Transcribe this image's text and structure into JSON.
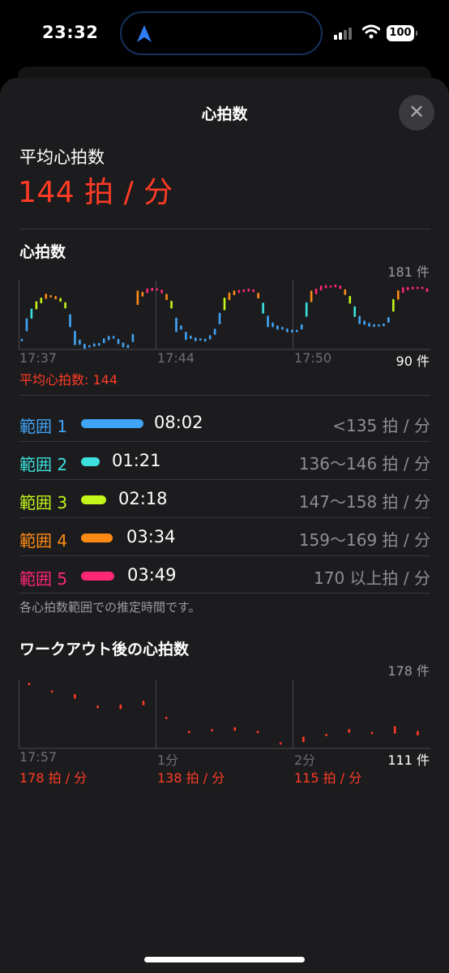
{
  "status": {
    "time": "23:32",
    "battery": "100"
  },
  "sheet": {
    "title": "心拍数",
    "close": "✕"
  },
  "average": {
    "label": "平均心拍数",
    "value": "144 拍 / 分"
  },
  "hr_chart": {
    "title": "心拍数",
    "count_top": "181 件",
    "count_bottom": "90 件",
    "time_labels": [
      "17:37",
      "17:44",
      "17:50"
    ],
    "avg_note": "平均心拍数: 144"
  },
  "ranges": [
    {
      "name": "範囲 1",
      "time": "08:02",
      "bpm": "<135 拍 / 分",
      "color": "#41a4f7"
    },
    {
      "name": "範囲 2",
      "time": "01:21",
      "bpm": "136～146 拍 / 分",
      "color": "#3ce0dd"
    },
    {
      "name": "範囲 3",
      "time": "02:18",
      "bpm": "147～158 拍 / 分",
      "color": "#c3f619"
    },
    {
      "name": "範囲 4",
      "time": "03:34",
      "bpm": "159～169 拍 / 分",
      "color": "#fd8a14"
    },
    {
      "name": "範囲 5",
      "time": "03:49",
      "bpm": "170 以上拍 / 分",
      "color": "#fe2773"
    }
  ],
  "ranges_note": "各心拍数範囲での推定時間です。",
  "recovery_chart": {
    "title": "ワークアウト後の心拍数",
    "count_top": "178 件",
    "count_bottom": "111 件",
    "time_labels": [
      "17:57",
      "1分",
      "2分"
    ],
    "sub_labels": [
      "178 拍 / 分",
      "138 拍 / 分",
      "115 拍 / 分"
    ]
  },
  "chart_data": [
    {
      "type": "scatter",
      "title": "心拍数",
      "x_ticks": [
        "17:37",
        "17:44",
        "17:50"
      ],
      "ylim": [
        90,
        181
      ],
      "y_ticks": [
        "181 件",
        "90 件"
      ],
      "zone_colors": [
        "#41a4f7",
        "#3ce0dd",
        "#c3f619",
        "#fd8a14",
        "#fe2773"
      ],
      "series": [
        {
          "values": [
            100,
            122,
            138,
            150,
            157,
            163,
            163,
            161,
            158,
            150,
            128,
            103,
            97,
            91,
            91,
            93,
            94,
            99,
            103,
            104,
            98,
            93,
            91,
            103,
            161,
            166,
            171,
            173,
            173,
            170,
            162,
            151,
            122,
            118,
            106,
            104,
            101,
            101,
            100,
            104,
            112,
            131,
            152,
            163,
            168,
            170,
            171,
            172,
            171,
            164,
            146,
            127,
            122,
            118,
            117,
            114,
            113,
            113,
            119,
            144,
            163,
            170,
            175,
            177,
            177,
            178,
            176,
            169,
            158,
            141,
            129,
            125,
            122,
            121,
            121,
            122,
            129,
            150,
            165,
            172,
            174,
            175,
            175,
            175,
            172
          ]
        }
      ]
    },
    {
      "type": "scatter",
      "title": "ワークアウト後の心拍数",
      "x_ticks": [
        "17:57",
        "1分",
        "2分"
      ],
      "ylim": [
        111,
        178
      ],
      "y_ticks": [
        "178 件",
        "111 件"
      ],
      "series": [
        {
          "values": [
            [
              178,
              178
            ],
            [
              170,
              170
            ],
            [
              161,
              166
            ],
            [
              151,
              154
            ],
            [
              150,
              155
            ],
            [
              154,
              159
            ],
            [
              140,
              142
            ],
            [
              127,
              127
            ],
            [
              129,
              129
            ],
            [
              127,
              131
            ],
            [
              127,
              127
            ],
            [
              113,
              115
            ],
            [
              115,
              121
            ],
            [
              124,
              124
            ],
            [
              125,
              129
            ],
            [
              126,
              126
            ],
            [
              124,
              132
            ],
            [
              122,
              127
            ]
          ]
        }
      ]
    }
  ]
}
